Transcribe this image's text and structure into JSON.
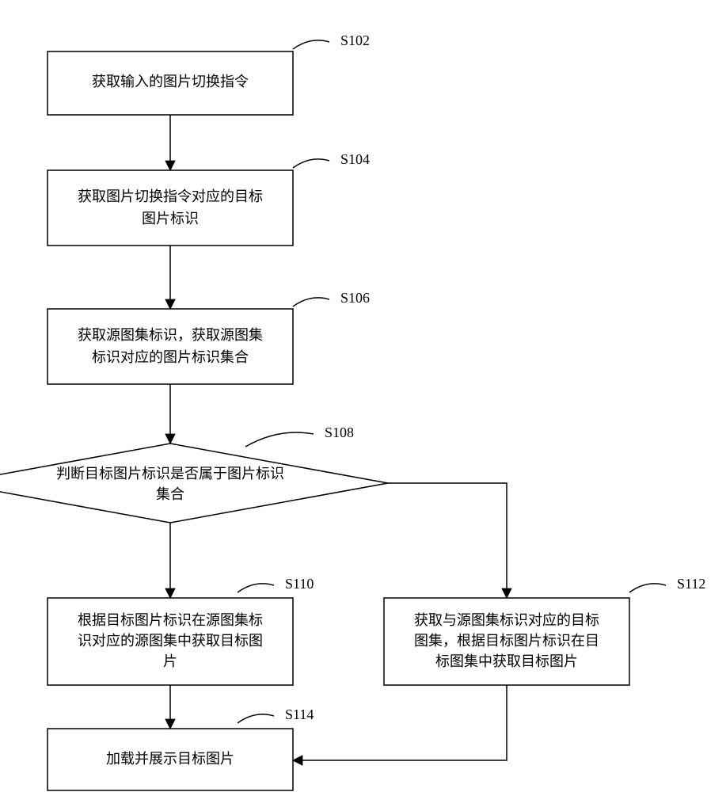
{
  "steps": {
    "s102": {
      "label": "S102",
      "text": "获取输入的图片切换指令"
    },
    "s104": {
      "label": "S104",
      "text_l1": "获取图片切换指令对应的目标",
      "text_l2": "图片标识"
    },
    "s106": {
      "label": "S106",
      "text_l1": "获取源图集标识，获取源图集",
      "text_l2": "标识对应的图片标识集合"
    },
    "s108": {
      "label": "S108",
      "text_l1": "判断目标图片标识是否属于图片标识",
      "text_l2": "集合"
    },
    "s110": {
      "label": "S110",
      "text_l1": "根据目标图片标识在源图集标",
      "text_l2": "识对应的源图集中获取目标图",
      "text_l3": "片"
    },
    "s112": {
      "label": "S112",
      "text_l1": "获取与源图集标识对应的目标",
      "text_l2": "图集，根据目标图片标识在目",
      "text_l3": "标图集中获取目标图片"
    },
    "s114": {
      "label": "S114",
      "text": "加载并展示目标图片"
    }
  }
}
